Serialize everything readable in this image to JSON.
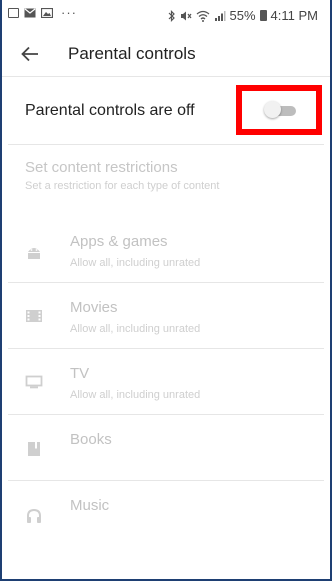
{
  "status_bar": {
    "notification_icons": [
      "calendar-icon",
      "mail-icon",
      "image-icon"
    ],
    "more_notifications": "···",
    "battery": "55%",
    "time": "4:11 PM",
    "system_icons": [
      "bluetooth-icon",
      "mute-icon",
      "wifi-icon",
      "signal-icon",
      "battery-icon"
    ]
  },
  "toolbar": {
    "back_icon": "arrow-back-icon",
    "title": "Parental controls"
  },
  "master_toggle": {
    "label": "Parental controls are off",
    "state": "off",
    "highlight_color": "#ff0000"
  },
  "restrictions": {
    "title": "Set content restrictions",
    "subtitle": "Set a restriction for each type of content",
    "disabled_text_color": "#c2c2c2",
    "items": [
      {
        "name": "Apps & games",
        "description": "Allow all, including unrated",
        "icon": "android-icon"
      },
      {
        "name": "Movies",
        "description": "Allow all, including unrated",
        "icon": "film-icon"
      },
      {
        "name": "TV",
        "description": "Allow all, including unrated",
        "icon": "tv-icon"
      },
      {
        "name": "Books",
        "description": "",
        "icon": "book-icon"
      },
      {
        "name": "Music",
        "description": "",
        "icon": "headphones-icon"
      }
    ]
  }
}
